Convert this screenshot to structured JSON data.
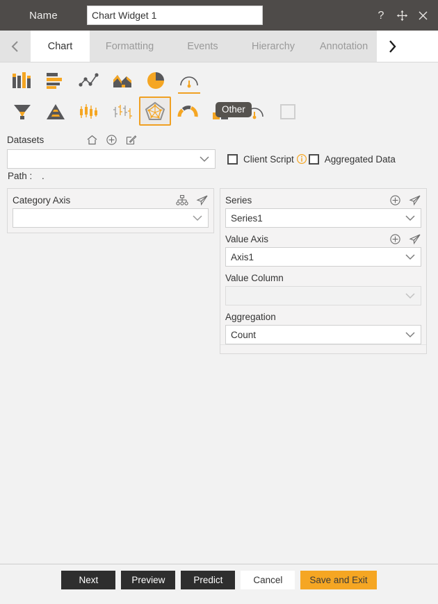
{
  "header": {
    "name_label": "Name",
    "widget_name": "Chart Widget 1",
    "widget_name_placeholder": "",
    "help_icon": "question-mark-icon",
    "move_icon": "move-icon",
    "close_icon": "close-icon"
  },
  "tabs": {
    "prev_label": "‹",
    "next_label": "›",
    "items": [
      {
        "label": "Chart",
        "active": true
      },
      {
        "label": "Formatting",
        "active": false
      },
      {
        "label": "Events",
        "active": false
      },
      {
        "label": "Hierarchy",
        "active": false
      },
      {
        "label": "Annotation",
        "active": false
      }
    ]
  },
  "chart_types": {
    "row1": [
      {
        "name": "column-chart-icon",
        "selected": false,
        "underlined": false
      },
      {
        "name": "bar-chart-icon",
        "selected": false,
        "underlined": false
      },
      {
        "name": "scatter-line-chart-icon",
        "selected": false,
        "underlined": false
      },
      {
        "name": "area-chart-icon",
        "selected": false,
        "underlined": false
      },
      {
        "name": "pie-chart-icon",
        "selected": false,
        "underlined": false
      },
      {
        "name": "gauge-chart-icon",
        "selected": false,
        "underlined": true
      }
    ],
    "row2": [
      {
        "name": "funnel-chart-icon",
        "selected": false
      },
      {
        "name": "pyramid-chart-icon",
        "selected": false
      },
      {
        "name": "candlestick-chart-icon",
        "selected": false
      },
      {
        "name": "ohlc-chart-icon",
        "selected": false
      },
      {
        "name": "radar-chart-icon",
        "selected": true
      },
      {
        "name": "half-gauge-chart-icon",
        "selected": false
      },
      {
        "name": "bullet-chart-icon",
        "selected": false
      },
      {
        "name": "dial-gauge-chart-icon",
        "selected": false
      },
      {
        "name": "placeholder-box-icon",
        "selected": false
      }
    ],
    "tooltip": "Other"
  },
  "datasets": {
    "label": "Datasets",
    "home_icon": "home-icon",
    "add_icon": "plus-circle-icon",
    "edit_icon": "edit-icon",
    "value": "",
    "placeholder": "",
    "client_script": {
      "label": "Client Script",
      "checked": false,
      "info_icon": "info-icon"
    },
    "aggregated_data": {
      "label": "Aggregated Data",
      "checked": false
    },
    "path_label": "Path :",
    "path_value": "."
  },
  "category_axis": {
    "title": "Category Axis",
    "hierarchy_icon": "hierarchy-icon",
    "send_icon": "send-icon",
    "value": "",
    "placeholder": ""
  },
  "series_panel": {
    "series": {
      "title": "Series",
      "add_icon": "plus-circle-icon",
      "send_icon": "send-icon",
      "value": "Series1"
    },
    "value_axis": {
      "title": "Value Axis",
      "add_icon": "plus-circle-icon",
      "send_icon": "send-icon",
      "value": "Axis1"
    },
    "value_column": {
      "title": "Value Column",
      "value": "",
      "placeholder": "",
      "disabled": true
    },
    "aggregation": {
      "title": "Aggregation",
      "value": "Count"
    }
  },
  "footer": {
    "next": "Next",
    "preview": "Preview",
    "predict": "Predict",
    "cancel": "Cancel",
    "save_and_exit": "Save and Exit"
  },
  "colors": {
    "header_bg": "#4e4b49",
    "accent": "#f5a623",
    "body_bg": "#f2f2f2",
    "dark_button": "#2e2e2e",
    "icon_gray": "#58585a"
  }
}
